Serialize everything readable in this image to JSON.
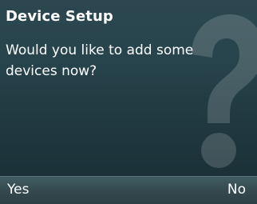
{
  "dialog": {
    "title": "Device Setup",
    "message": "Would you like to add some devices now?",
    "background_icon": "question-mark-icon"
  },
  "softkeys": {
    "left_label": "Yes",
    "right_label": "No"
  },
  "colors": {
    "background": "#243a41",
    "softkey_bar": "#34484d",
    "text": "#ffffff"
  }
}
